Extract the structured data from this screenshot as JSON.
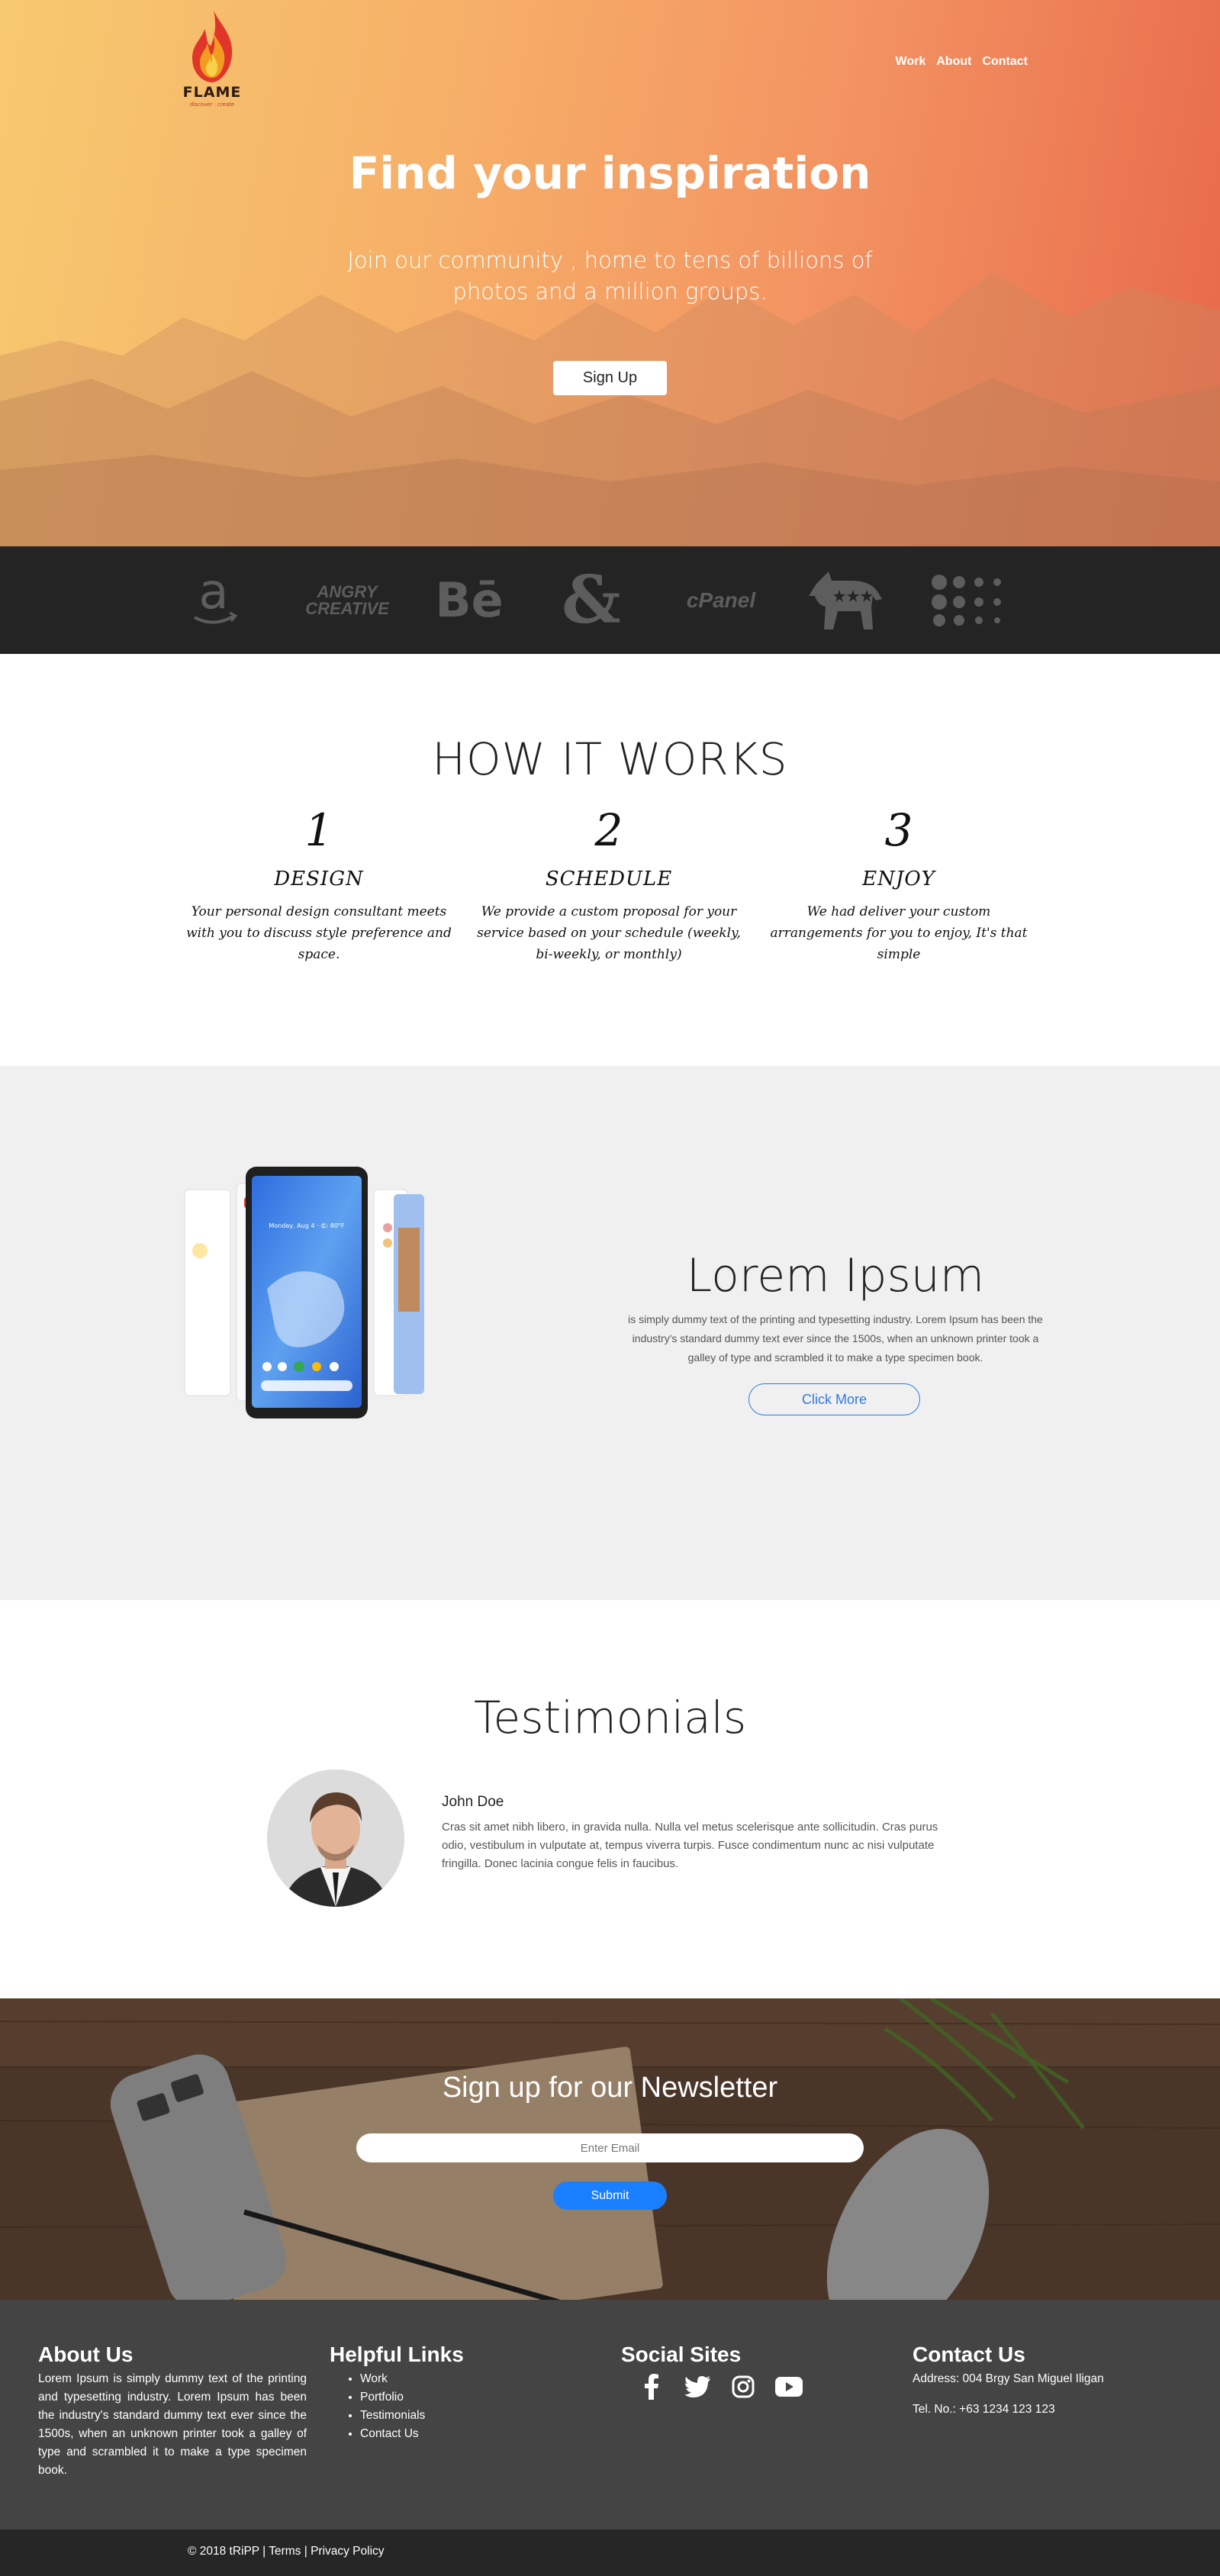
{
  "header": {
    "brand": "FLAME",
    "brand_tagline": "discover · create",
    "nav": [
      "Work",
      "About",
      "Contact"
    ]
  },
  "hero": {
    "title": "Find your inspiration",
    "subtitle_line1": "Join our community , home to tens of billions of",
    "subtitle_line2": "photos and a million groups.",
    "cta": "Sign Up"
  },
  "brands": {
    "items": [
      "amazon-logo",
      "angry-creative-logo",
      "behance-logo",
      "dungeons-dragons-logo",
      "cpanel-logo",
      "democrat-logo",
      "dots-logo"
    ],
    "angry_line1": "ANGRY",
    "angry_line2": "CREATIVE",
    "behance": "Bē",
    "cpanel": "cPanel"
  },
  "how": {
    "title": "HOW IT WORKS",
    "steps": [
      {
        "num": "1",
        "title": "DESIGN",
        "desc": "Your personal design consultant meets with you to discuss style preference and space."
      },
      {
        "num": "2",
        "title": "SCHEDULE",
        "desc": "We provide a custom proposal for your service based on your schedule (weekly, bi-weekly, or monthly)"
      },
      {
        "num": "3",
        "title": "ENJOY",
        "desc": "We had deliver your custom arrangements for you to enjoy, It's that simple"
      }
    ]
  },
  "feature": {
    "title": "Lorem Ipsum",
    "text": "is simply dummy text of the printing and typesetting industry. Lorem Ipsum has been the industry's standard dummy text ever since the 1500s, when an unknown printer took a galley of type and scrambled it to make a type specimen book.",
    "button": "Click More",
    "phone_time": "Monday, Aug 4 · 🌤 80°F"
  },
  "testimonials": {
    "title": "Testimonials",
    "name": "John Doe",
    "quote": "Cras sit amet nibh libero, in gravida nulla. Nulla vel metus scelerisque ante sollicitudin. Cras purus odio, vestibulum in vulputate at, tempus viverra turpis. Fusce condimentum nunc ac nisi vulputate fringilla. Donec lacinia congue felis in faucibus."
  },
  "newsletter": {
    "title": "Sign up for our Newsletter",
    "email_placeholder": "Enter Email",
    "submit": "Submit"
  },
  "footer": {
    "about_title": "About Us",
    "about_text": "Lorem Ipsum is simply dummy text of the printing and typesetting industry. Lorem Ipsum has been the industry's standard dummy text ever since the 1500s, when an unknown printer took a galley of type and scrambled it to make a type specimen book.",
    "links_title": "Helpful Links",
    "links": [
      "Work",
      "Portfolio",
      "Testimonials",
      "Contact Us"
    ],
    "social_title": "Social Sites",
    "social": [
      "facebook-icon",
      "twitter-icon",
      "instagram-icon",
      "youtube-icon"
    ],
    "contact_title": "Contact Us",
    "address": "Address: 004 Brgy San Miguel Iligan",
    "phone": "Tel. No.: +63 1234 123 123"
  },
  "bottom": {
    "copyright": "© 2018 tRiPP",
    "sep": " | ",
    "terms": "Terms",
    "privacy": "Privacy Policy"
  },
  "colors": {
    "accent_blue": "#1a7fff",
    "footer_bg": "#444444",
    "brand_bar_bg": "#242424"
  }
}
